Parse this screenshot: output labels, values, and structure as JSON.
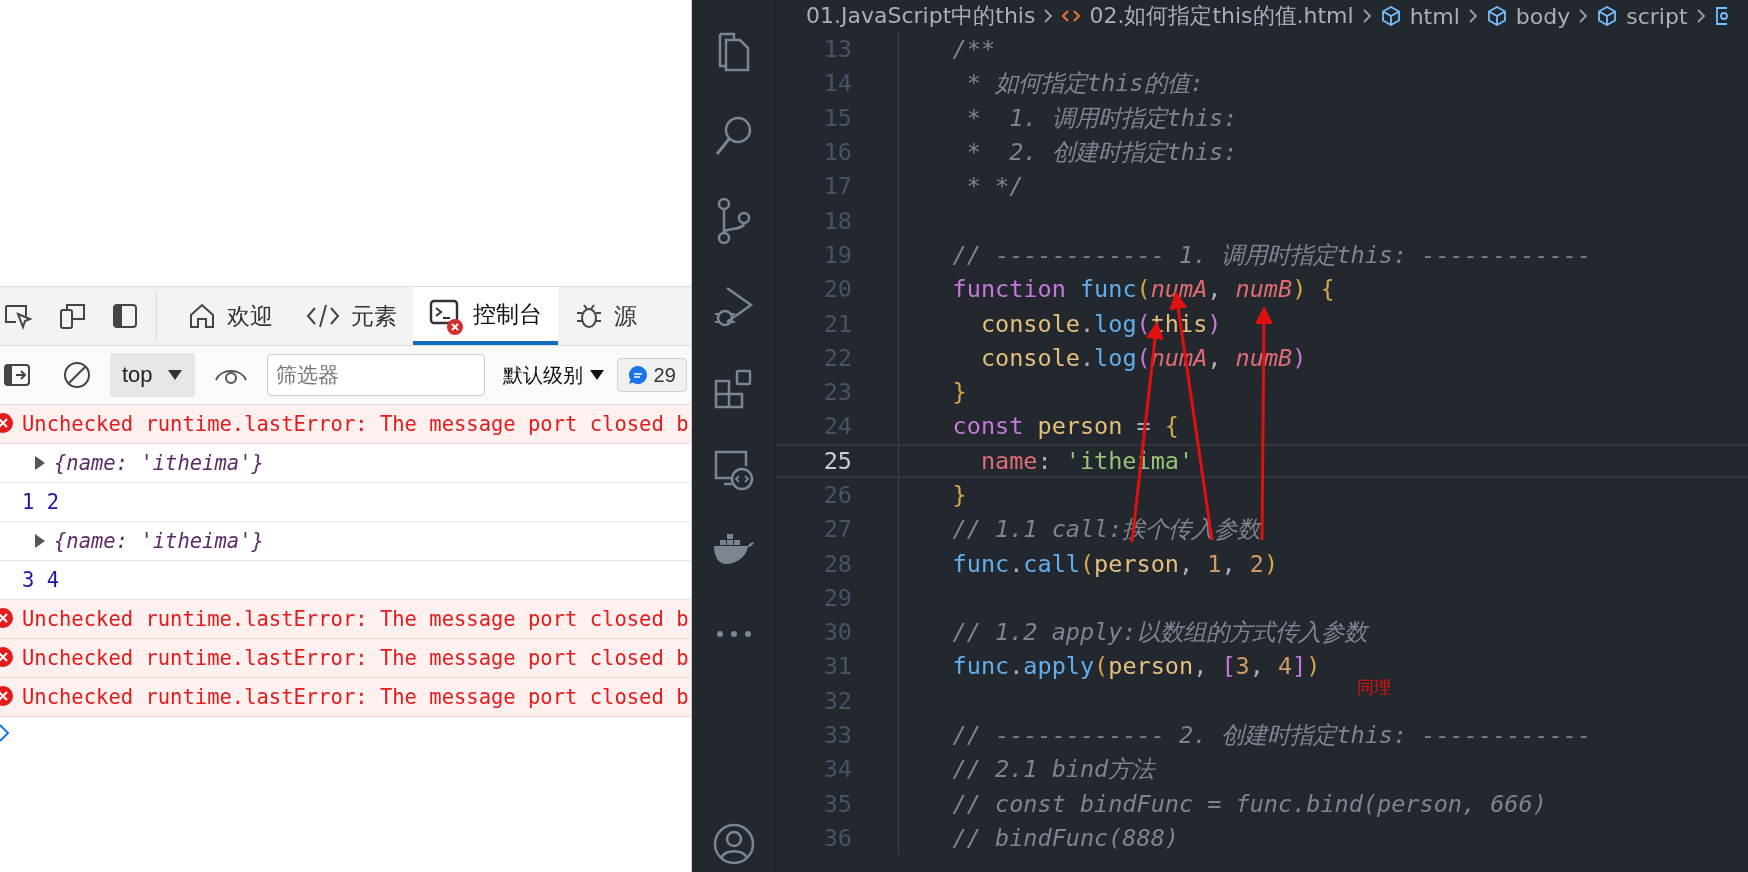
{
  "devtools": {
    "tabs": [
      {
        "label": "欢迎",
        "selected": false,
        "error": false
      },
      {
        "label": "元素",
        "selected": false,
        "error": false
      },
      {
        "label": "控制台",
        "selected": true,
        "error": true
      },
      {
        "label": "源",
        "selected": false,
        "error": false
      }
    ],
    "toolbar": {
      "context": "top",
      "filter_placeholder": "筛选器",
      "log_levels": "默认级别",
      "message_count": "29"
    },
    "console": [
      {
        "kind": "error",
        "text": "Unchecked runtime.lastError: The message port closed b"
      },
      {
        "kind": "object",
        "text": "{name: 'itheima'}"
      },
      {
        "kind": "value",
        "text": "1 2"
      },
      {
        "kind": "object",
        "text": "{name: 'itheima'}"
      },
      {
        "kind": "value",
        "text": "3 4"
      },
      {
        "kind": "error",
        "text": "Unchecked runtime.lastError: The message port closed b"
      },
      {
        "kind": "error",
        "text": "Unchecked runtime.lastError: The message port closed b"
      },
      {
        "kind": "error",
        "text": "Unchecked runtime.lastError: The message port closed b"
      }
    ]
  },
  "editor": {
    "breadcrumb": [
      {
        "kind": "folder",
        "label": "01.JavaScript中的this"
      },
      {
        "kind": "file",
        "label": "02.如何指定this的值.html"
      },
      {
        "kind": "element",
        "label": "html"
      },
      {
        "kind": "element",
        "label": "body"
      },
      {
        "kind": "element",
        "label": "script"
      }
    ],
    "lines": [
      {
        "number": "13",
        "current": false,
        "tokens": [
          {
            "kind": "comment",
            "text": "    /**"
          }
        ]
      },
      {
        "number": "14",
        "current": false,
        "tokens": [
          {
            "kind": "comment",
            "text": "     * 如何指定this的值:"
          }
        ]
      },
      {
        "number": "15",
        "current": false,
        "tokens": [
          {
            "kind": "comment",
            "text": "     *  1. 调用时指定this:"
          }
        ]
      },
      {
        "number": "16",
        "current": false,
        "tokens": [
          {
            "kind": "comment",
            "text": "     *  2. 创建时指定this:"
          }
        ]
      },
      {
        "number": "17",
        "current": false,
        "tokens": [
          {
            "kind": "comment",
            "text": "     * */"
          }
        ]
      },
      {
        "number": "18",
        "current": false
      },
      {
        "number": "19",
        "current": false,
        "tokens": [
          {
            "kind": "comment",
            "text": "    // ------------ 1. 调用时指定this: ------------"
          }
        ]
      },
      {
        "number": "20",
        "current": false,
        "tokens": [
          {
            "kind": "keyword",
            "text": "    function "
          },
          {
            "kind": "function",
            "text": "func"
          },
          {
            "kind": "bracket1",
            "text": "("
          },
          {
            "kind": "param",
            "text": "numA"
          },
          {
            "kind": "plain",
            "text": ", "
          },
          {
            "kind": "param",
            "text": "numB"
          },
          {
            "kind": "bracket1",
            "text": ") {"
          }
        ]
      },
      {
        "number": "21",
        "current": false,
        "tokens": [
          {
            "kind": "variable",
            "text": "      console"
          },
          {
            "kind": "plain",
            "text": "."
          },
          {
            "kind": "function",
            "text": "log"
          },
          {
            "kind": "bracket2",
            "text": "("
          },
          {
            "kind": "variable",
            "text": "this"
          },
          {
            "kind": "bracket2",
            "text": ")"
          }
        ]
      },
      {
        "number": "22",
        "current": false,
        "tokens": [
          {
            "kind": "variable",
            "text": "      console"
          },
          {
            "kind": "plain",
            "text": "."
          },
          {
            "kind": "function",
            "text": "log"
          },
          {
            "kind": "bracket2",
            "text": "("
          },
          {
            "kind": "param",
            "text": "numA"
          },
          {
            "kind": "plain",
            "text": ", "
          },
          {
            "kind": "param",
            "text": "numB"
          },
          {
            "kind": "bracket2",
            "text": ")"
          }
        ]
      },
      {
        "number": "23",
        "current": false,
        "tokens": [
          {
            "kind": "bracket1",
            "text": "    }"
          }
        ]
      },
      {
        "number": "24",
        "current": false,
        "tokens": [
          {
            "kind": "keyword",
            "text": "    const "
          },
          {
            "kind": "variable",
            "text": "person"
          },
          {
            "kind": "plain",
            "text": " = "
          },
          {
            "kind": "bracket1",
            "text": "{"
          }
        ]
      },
      {
        "number": "25",
        "current": true,
        "tokens": [
          {
            "kind": "property",
            "text": "      name"
          },
          {
            "kind": "plain",
            "text": ": "
          },
          {
            "kind": "string",
            "text": "'itheima'"
          }
        ]
      },
      {
        "number": "26",
        "current": false,
        "tokens": [
          {
            "kind": "bracket1",
            "text": "    }"
          }
        ]
      },
      {
        "number": "27",
        "current": false,
        "tokens": [
          {
            "kind": "comment",
            "text": "    // 1.1 call:挨个传入参数"
          }
        ]
      },
      {
        "number": "28",
        "current": false,
        "tokens": [
          {
            "kind": "function",
            "text": "    func"
          },
          {
            "kind": "plain",
            "text": "."
          },
          {
            "kind": "function",
            "text": "call"
          },
          {
            "kind": "bracket1",
            "text": "("
          },
          {
            "kind": "variable",
            "text": "person"
          },
          {
            "kind": "plain",
            "text": ", "
          },
          {
            "kind": "number",
            "text": "1"
          },
          {
            "kind": "plain",
            "text": ", "
          },
          {
            "kind": "number",
            "text": "2"
          },
          {
            "kind": "bracket1",
            "text": ")"
          }
        ]
      },
      {
        "number": "29",
        "current": false
      },
      {
        "number": "30",
        "current": false,
        "tokens": [
          {
            "kind": "comment",
            "text": "    // 1.2 apply:以数组的方式传入参数"
          }
        ]
      },
      {
        "number": "31",
        "current": false,
        "tokens": [
          {
            "kind": "function",
            "text": "    func"
          },
          {
            "kind": "plain",
            "text": "."
          },
          {
            "kind": "function",
            "text": "apply"
          },
          {
            "kind": "bracket1",
            "text": "("
          },
          {
            "kind": "variable",
            "text": "person"
          },
          {
            "kind": "plain",
            "text": ", "
          },
          {
            "kind": "bracket2",
            "text": "["
          },
          {
            "kind": "number",
            "text": "3"
          },
          {
            "kind": "plain",
            "text": ", "
          },
          {
            "kind": "number",
            "text": "4"
          },
          {
            "kind": "bracket2",
            "text": "]"
          },
          {
            "kind": "bracket1",
            "text": ")"
          }
        ]
      },
      {
        "number": "32",
        "current": false
      },
      {
        "number": "33",
        "current": false,
        "tokens": [
          {
            "kind": "comment",
            "text": "    // ------------ 2. 创建时指定this: ------------"
          }
        ]
      },
      {
        "number": "34",
        "current": false,
        "tokens": [
          {
            "kind": "comment",
            "text": "    // 2.1 bind方法"
          }
        ]
      },
      {
        "number": "35",
        "current": false,
        "tokens": [
          {
            "kind": "comment",
            "text": "    // const bindFunc = func.bind(person, 666)"
          }
        ]
      },
      {
        "number": "36",
        "current": false,
        "tokens": [
          {
            "kind": "comment",
            "text": "    // bindFunc(888)"
          }
        ]
      }
    ],
    "note": "同理"
  }
}
